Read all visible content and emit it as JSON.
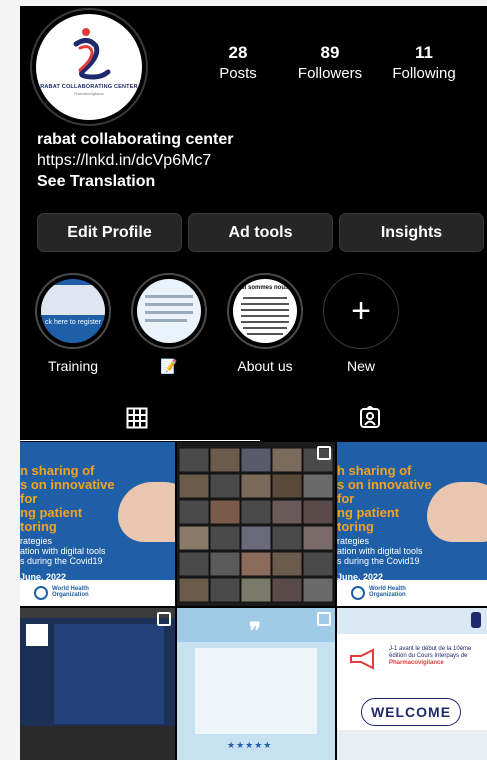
{
  "profile": {
    "avatar_logo_text": "RABAT COLLABORATING CENTER",
    "avatar_logo_sub": "Pharmacovigilance",
    "name": "rabat collaborating center",
    "link": "https://lnkd.in/dcVp6Mc7",
    "see_translation": "See Translation"
  },
  "stats": [
    {
      "value": "28",
      "label": "Posts"
    },
    {
      "value": "89",
      "label": "Followers"
    },
    {
      "value": "11",
      "label": "Following"
    }
  ],
  "buttons": {
    "edit_profile": "Edit Profile",
    "ad_tools": "Ad tools",
    "insights": "Insights"
  },
  "highlights": [
    {
      "label": "Training",
      "preview_text": "ck here to register"
    },
    {
      "label": "📝",
      "preview_text": ""
    },
    {
      "label": "About us",
      "preview_text": "Qui sommes nous ?"
    },
    {
      "label": "New",
      "preview_text": ""
    }
  ],
  "tabs": {
    "grid": "grid-icon",
    "tagged": "tagged-icon"
  },
  "posts": {
    "post1": {
      "lines": [
        "n sharing of",
        "s on innovative",
        "for",
        "ng patient",
        "toring"
      ],
      "sub": [
        "rategies",
        "ation with digital tools",
        "s during the Covid19"
      ],
      "date": "June, 2022",
      "org": "World Health Organization"
    },
    "post3": {
      "lines": [
        "h sharing of",
        "s on innovative",
        "for",
        "ng patient",
        "toring"
      ],
      "sub": [
        "rategies",
        "ation with digital tools",
        "s during the Covid19"
      ],
      "date": "June, 2022",
      "org": "World Health Organization"
    },
    "post6": {
      "text_line1": "J-1 avant le début de la 10ème",
      "text_line2": "édition du Cours Interpays de",
      "text_line3": "Pharmacovigilance",
      "welcome": "WELCOME"
    }
  },
  "colors": {
    "background": "#000000",
    "button_bg": "#262626",
    "post_blue": "#1f5fa8",
    "accent_orange": "#f6a21d"
  }
}
